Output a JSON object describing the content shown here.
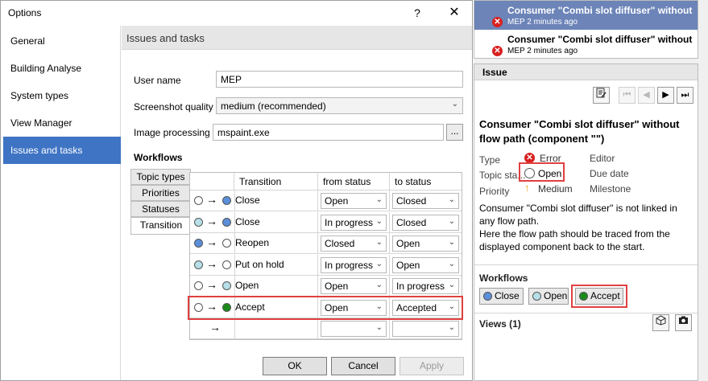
{
  "dialog": {
    "title": "Options",
    "help": "?",
    "close": "✕",
    "nav": [
      "General",
      "Building Analyse",
      "System types",
      "View Manager",
      "Issues and tasks"
    ],
    "section_title": "Issues and tasks",
    "user_name_label": "User name",
    "user_name_value": "MEP",
    "screenshot_label": "Screenshot quality",
    "screenshot_value": "medium (recommended)",
    "image_label": "Image processing",
    "image_value": "mspaint.exe",
    "browse": "...",
    "workflows_label": "Workflows",
    "tabs": [
      "Topic types",
      "Priorities",
      "Statuses",
      "Transition"
    ],
    "columns": [
      "Transition",
      "from status",
      "to status"
    ],
    "rows": [
      {
        "from_color": "#ffffff",
        "to_color": "#5b8fd9",
        "name": "Close",
        "from_status": "Open",
        "to_status": "Closed"
      },
      {
        "from_color": "#b7dfe8",
        "to_color": "#5b8fd9",
        "name": "Close",
        "from_status": "In progress",
        "to_status": "Closed"
      },
      {
        "from_color": "#5b8fd9",
        "to_color": "#ffffff",
        "name": "Reopen",
        "from_status": "Closed",
        "to_status": "Open"
      },
      {
        "from_color": "#b7dfe8",
        "to_color": "#ffffff",
        "name": "Put on hold",
        "from_status": "In progress",
        "to_status": "Open"
      },
      {
        "from_color": "#ffffff",
        "to_color": "#b7dfe8",
        "name": "Open",
        "from_status": "Open",
        "to_status": "In progress"
      },
      {
        "from_color": "#ffffff",
        "to_color": "#1a8a1a",
        "name": "Accept",
        "from_status": "Open",
        "to_status": "Accepted"
      }
    ],
    "arrow": "→",
    "buttons": {
      "ok": "OK",
      "cancel": "Cancel",
      "apply": "Apply"
    }
  },
  "notifications": [
    {
      "title": "Consumer \"Combi slot diffuser\" without flow path",
      "sub": "MEP 2 minutes ago"
    },
    {
      "title": "Consumer \"Combi slot diffuser\" without flow path",
      "sub": "MEP 2 minutes ago"
    }
  ],
  "issue": {
    "header": "Issue",
    "title": "Consumer \"Combi slot diffuser\" without flow path (component \"\")",
    "type_label": "Type",
    "type_value": "Error",
    "status_label": "Topic sta...",
    "status_value": "Open",
    "priority_label": "Priority",
    "priority_value": "Medium",
    "editor_label": "Editor",
    "due_label": "Due date",
    "milestone_label": "Milestone",
    "description": "Consumer \"Combi slot diffuser\" is not linked in any flow path.\nHere the flow path should be traced from the displayed component back to the start.",
    "workflows_label": "Workflows",
    "workflow_buttons": [
      {
        "label": "Close",
        "color": "#5b8fd9"
      },
      {
        "label": "Open",
        "color": "#b7dfe8"
      },
      {
        "label": "Accept",
        "color": "#1a8a1a"
      }
    ],
    "views_label": "Views (1)"
  }
}
